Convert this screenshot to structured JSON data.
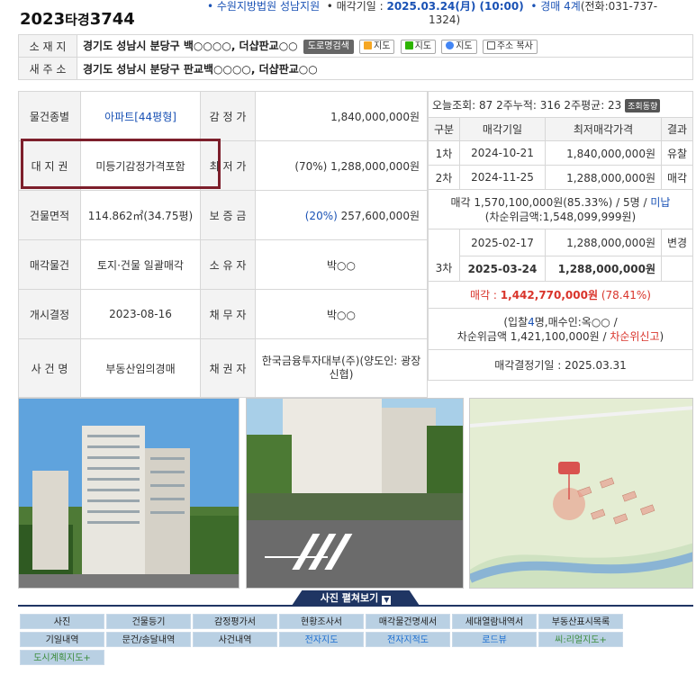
{
  "header": {
    "case_year": "2023",
    "case_type": "타경",
    "case_num": "3744",
    "court": "• 수원지방법원 성남지원",
    "sale_label": "• 매각기일 : ",
    "sale_date": "2025.03.24(月) (10:00)",
    "dept": "• 경매 4계",
    "phone_a": "(전화:031-737-",
    "phone_b": "1324)"
  },
  "address": {
    "jibun_label": "소 재 지",
    "jibun": "경기도 성남시 분당구 백○○○○, 더샵판교○○",
    "road_label": "새 주 소",
    "road": "경기도 성남시 분당구 판교백○○○○, 더샵판교○○",
    "buttons": [
      "도로명검색",
      "지도",
      "지도",
      "지도",
      "주소 복사"
    ]
  },
  "details": {
    "rows": [
      {
        "l1": "물건종별",
        "v1": "아파트[44평형]",
        "l2": "감 정 가",
        "v2": "1,840,000,000원"
      },
      {
        "l1": "대 지 권",
        "v1": "미등기감정가격포함",
        "l2": "최 저 가",
        "v2": "(70%) 1,288,000,000원"
      },
      {
        "l1": "건물면적",
        "v1": "114.862㎡(34.75평)",
        "l2": "보 증 금",
        "v2a": "(20%)",
        "v2b": " 257,600,000원"
      },
      {
        "l1": "매각물건",
        "v1": "토지·건물 일괄매각",
        "l2": "소 유 자",
        "v2": "박○○"
      },
      {
        "l1": "개시결정",
        "v1": "2023-08-16",
        "l2": "채 무 자",
        "v2": "박○○"
      },
      {
        "l1": "사 건 명",
        "v1": "부동산임의경매",
        "l2": "채 권 자",
        "v2": "한국금융투자대부(주)(양도인: 광장신협)"
      }
    ]
  },
  "history": {
    "views": "오늘조회: 87 2주누적: 316 2주평균: 23",
    "views_btn": "조회동향",
    "cols": [
      "구분",
      "매각기일",
      "최저매각가격",
      "결과"
    ],
    "r1": {
      "round": "1차",
      "date": "2024-10-21",
      "price": "1,840,000,000원",
      "result": "유찰"
    },
    "r2": {
      "round": "2차",
      "date": "2024-11-25",
      "price": "1,288,000,000원",
      "result": "매각"
    },
    "r2_note_a": "매각 1,570,100,000원(85.33%) / 5명 / ",
    "r2_note_b": "미납",
    "r2_note_c": "(차순위금액:1,548,099,999원)",
    "r3a": {
      "date": "2025-02-17",
      "price": "1,288,000,000원",
      "result": "변경"
    },
    "r3b": {
      "round": "3차",
      "date": "2025-03-24",
      "price": "1,288,000,000원"
    },
    "sold_label": "매각 : ",
    "sold_value": "1,442,770,000원",
    "sold_pct": " (78.41%)",
    "bid_a": "(입찰",
    "bid_n": "4",
    "bid_b": "명,매수인:옥○○ /",
    "bid_c": "차순위금액 1,421,100,000원 / ",
    "bid_d": "차순위신고",
    "bid_e": ")",
    "decision": "매각결정기일 : 2025.03.31"
  },
  "photos": {
    "expand": "사진 펼쳐보기"
  },
  "links": {
    "row1": [
      "사진",
      "건물등기",
      "감정평가서",
      "현황조사서",
      "매각물건명세서",
      "세대열람내역서",
      "부동산표시목록"
    ],
    "row2": [
      "기일내역",
      "문건/송달내역",
      "사건내역",
      "전자지도",
      "전자지적도",
      "로드뷰",
      "씨:리얼지도+"
    ],
    "row3": [
      "도시계획지도+"
    ]
  },
  "colors": {
    "accent": "#1a52b5",
    "red": "#d9342b",
    "box": "#7d1f2b",
    "bar": "#1f3563"
  }
}
